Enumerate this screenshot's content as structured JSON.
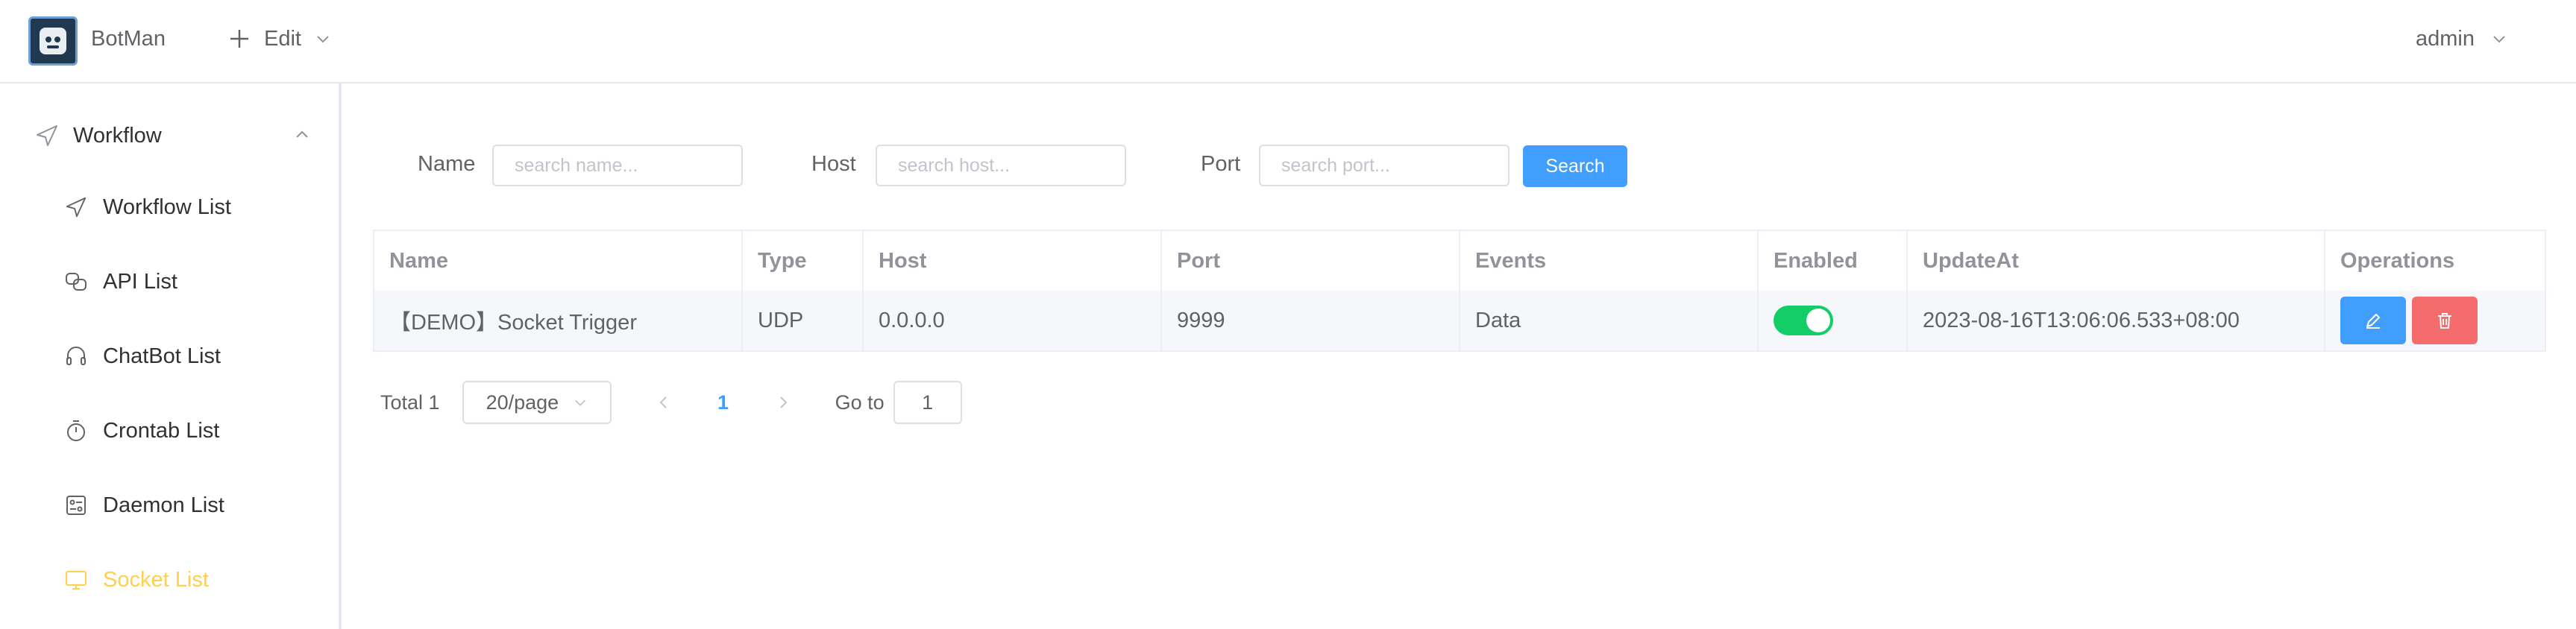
{
  "header": {
    "brand": "BotMan",
    "edit_label": "Edit",
    "user_label": "admin"
  },
  "sidebar": {
    "group_label": "Workflow",
    "items": [
      {
        "label": "Workflow List",
        "icon": "send-icon"
      },
      {
        "label": "API List",
        "icon": "link-icon"
      },
      {
        "label": "ChatBot List",
        "icon": "headset-icon"
      },
      {
        "label": "Crontab List",
        "icon": "timer-icon"
      },
      {
        "label": "Daemon List",
        "icon": "panel-icon"
      },
      {
        "label": "Socket List",
        "icon": "monitor-icon",
        "active": true
      }
    ],
    "active_color": "#ffd04b"
  },
  "filters": {
    "name_label": "Name",
    "name_placeholder": "search name...",
    "host_label": "Host",
    "host_placeholder": "search host...",
    "port_label": "Port",
    "port_placeholder": "search port...",
    "search_label": "Search"
  },
  "table": {
    "columns": [
      "Name",
      "Type",
      "Host",
      "Port",
      "Events",
      "Enabled",
      "UpdateAt",
      "Operations"
    ],
    "rows": [
      {
        "name": "【DEMO】Socket Trigger",
        "type": "UDP",
        "host": "0.0.0.0",
        "port": "9999",
        "events": "Data",
        "enabled": true,
        "update_at": "2023-08-16T13:06:06.533+08:00"
      }
    ]
  },
  "pagination": {
    "total_label": "Total 1",
    "page_size": "20/page",
    "current_page": "1",
    "goto_label": "Go to",
    "goto_value": "1"
  },
  "colors": {
    "primary": "#409eff",
    "danger": "#f56c6c",
    "success": "#13ce66"
  }
}
